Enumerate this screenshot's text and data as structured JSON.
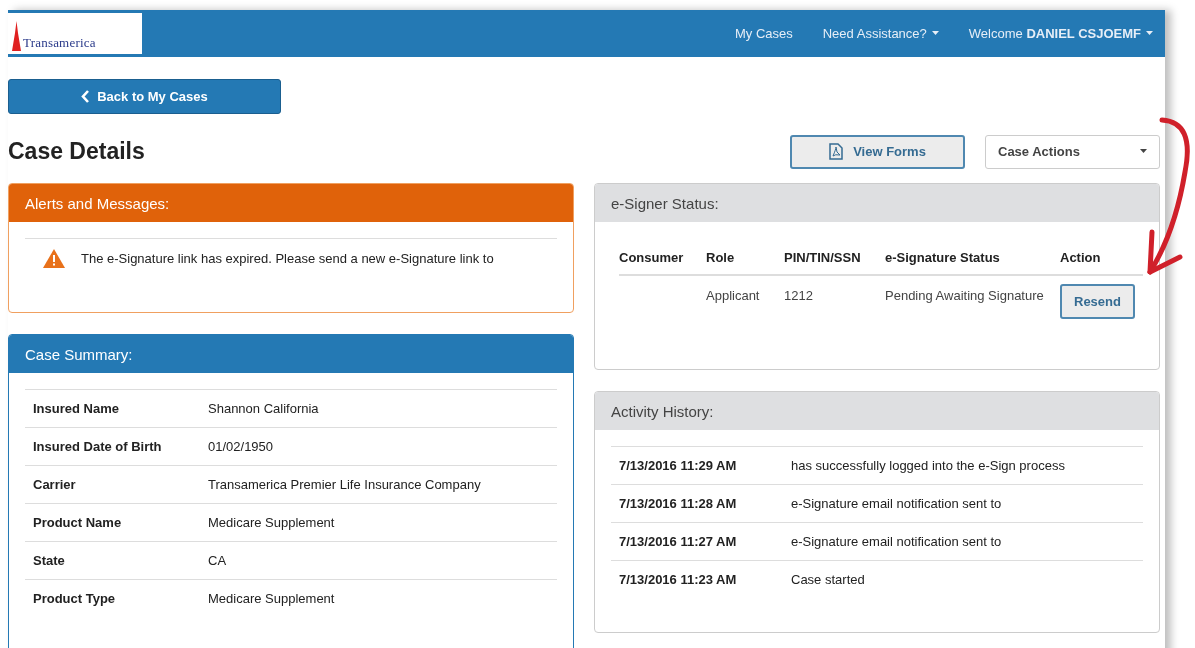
{
  "header": {
    "logo": "Transamerica",
    "nav": [
      {
        "label": "My Cases",
        "kind": "link"
      },
      {
        "label": "Need Assistance?",
        "kind": "menu"
      },
      {
        "label": "Welcome",
        "user": "DANIEL CSJOEMF",
        "kind": "user"
      }
    ]
  },
  "back_button": "Back to My Cases",
  "page_title": "Case Details",
  "actions": {
    "view_forms": "View Forms",
    "case_actions": "Case Actions"
  },
  "alerts": {
    "title": "Alerts and Messages:",
    "messages": [
      "The e-Signature link has expired. Please send a new e-Signature link to"
    ]
  },
  "case_summary": {
    "title": "Case Summary:",
    "rows": [
      {
        "label": "Insured Name",
        "value": "Shannon California"
      },
      {
        "label": "Insured Date of Birth",
        "value": "01/02/1950"
      },
      {
        "label": "Carrier",
        "value": "Transamerica Premier Life Insurance Company"
      },
      {
        "label": "Product Name",
        "value": "Medicare Supplement"
      },
      {
        "label": "State",
        "value": "CA"
      },
      {
        "label": "Product Type",
        "value": "Medicare Supplement"
      }
    ]
  },
  "esigner": {
    "title": "e-Signer Status:",
    "columns": [
      "Consumer",
      "Role",
      "PIN/TIN/SSN",
      "e-Signature Status",
      "Action"
    ],
    "rows": [
      {
        "consumer": "",
        "role": "Applicant",
        "pin": "1212",
        "status": "Pending Awaiting Signature",
        "action": "Resend"
      }
    ]
  },
  "activity": {
    "title": "Activity History:",
    "rows": [
      {
        "time": "7/13/2016 11:29 AM",
        "text": "has successfully logged into the e-Sign process"
      },
      {
        "time": "7/13/2016 11:28 AM",
        "text": "e-Signature email notification sent to"
      },
      {
        "time": "7/13/2016 11:27 AM",
        "text": "e-Signature email notification sent to"
      },
      {
        "time": "7/13/2016 11:23 AM",
        "text": "Case started"
      }
    ]
  }
}
